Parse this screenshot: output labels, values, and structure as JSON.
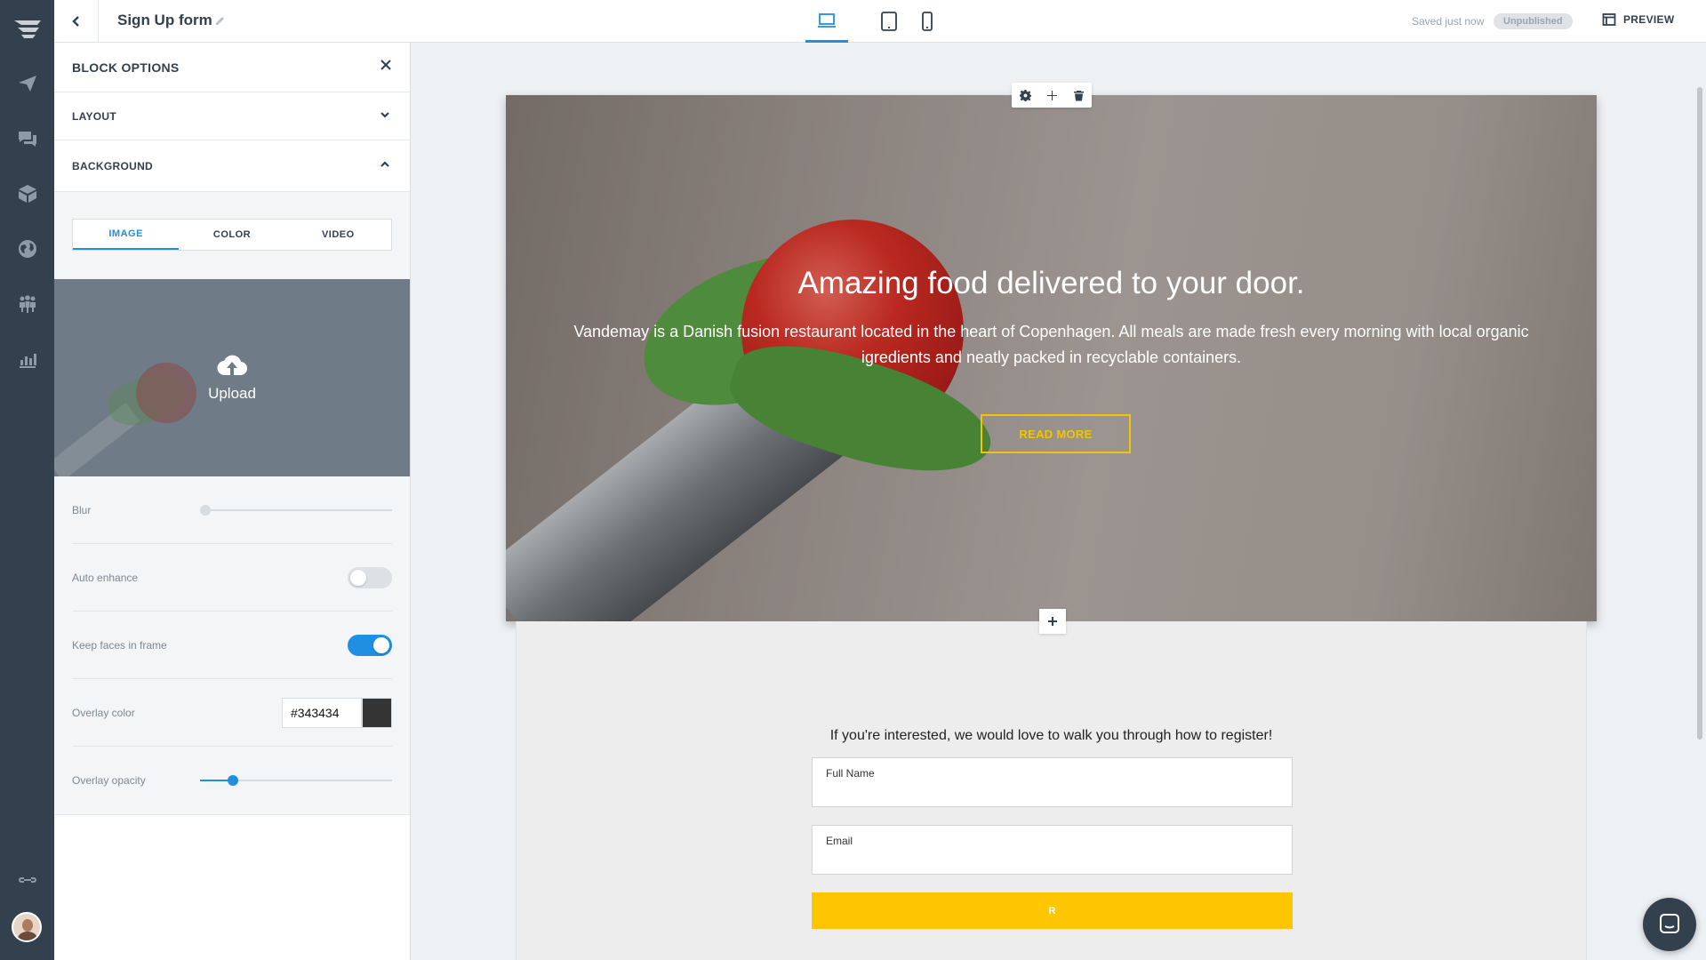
{
  "topbar": {
    "page_title": "Sign Up form",
    "saved_status": "Saved just now",
    "publish_badge": "Unpublished",
    "preview_label": "PREVIEW"
  },
  "rail": {
    "icons": [
      "logo-icon",
      "paper-plane-icon",
      "chat-bubbles-icon",
      "box-icon",
      "globe-icon",
      "people-icon",
      "bar-chart-icon",
      "link-icon"
    ]
  },
  "panel": {
    "title": "BLOCK OPTIONS",
    "sections": {
      "layout": "LAYOUT",
      "background": "BACKGROUND"
    },
    "tabs": [
      "IMAGE",
      "COLOR",
      "VIDEO"
    ],
    "active_tab": "IMAGE",
    "upload_label": "Upload",
    "options": {
      "blur_label": "Blur",
      "blur_value": 0,
      "auto_enhance_label": "Auto enhance",
      "auto_enhance_on": false,
      "keep_faces_label": "Keep faces in frame",
      "keep_faces_on": true,
      "overlay_color_label": "Overlay color",
      "overlay_color_value": "#343434",
      "overlay_opacity_label": "Overlay opacity",
      "overlay_opacity_value": 0.15
    }
  },
  "hero": {
    "title": "Amazing food delivered to your door.",
    "subtitle": "Vandemay is a Danish fusion restaurant located in the heart of Copenhagen. All meals are made fresh every morning with local organic igredients and neatly packed in recyclable containers.",
    "button_label": "READ MORE"
  },
  "form": {
    "intro": "If you're interested, we would love to walk you through how to register!",
    "fields": [
      "Full Name",
      "Email"
    ],
    "submit_label": "R"
  },
  "colors": {
    "accent": "#1e8fe1",
    "rail_bg": "#33404d",
    "cta_yellow": "#fec600",
    "overlay": "#343434"
  }
}
